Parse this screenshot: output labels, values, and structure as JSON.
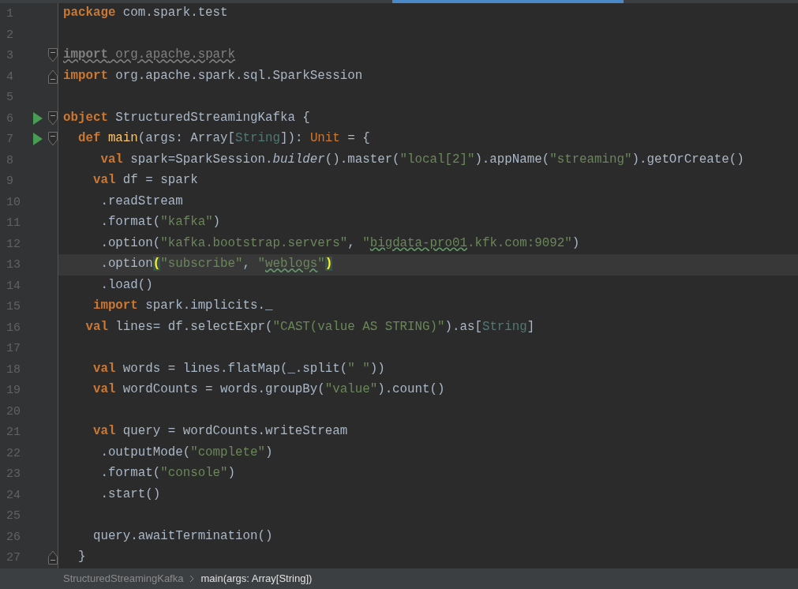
{
  "editor": {
    "lines": [
      {
        "number": "1",
        "run": false,
        "fold_start": false,
        "fold_end": false,
        "current": false,
        "tokens": [
          {
            "kind": "keyword",
            "text": "package"
          },
          {
            "kind": "plain",
            "text": " com.spark.test"
          }
        ]
      },
      {
        "number": "2",
        "run": false,
        "fold_start": false,
        "fold_end": false,
        "current": false
      },
      {
        "number": "3",
        "run": false,
        "fold_start": true,
        "fold_end": false,
        "current": false,
        "tokens": [
          {
            "kind": "unused-keyword",
            "text": "import"
          },
          {
            "kind": "unused",
            "text": " org.apache.spark"
          }
        ]
      },
      {
        "number": "4",
        "run": false,
        "fold_start": false,
        "fold_end": true,
        "current": false,
        "tokens": [
          {
            "kind": "keyword",
            "text": "import"
          },
          {
            "kind": "plain",
            "text": " org.apache.spark.sql.SparkSession"
          }
        ]
      },
      {
        "number": "5",
        "run": false,
        "fold_start": false,
        "fold_end": false,
        "current": false
      },
      {
        "number": "6",
        "run": true,
        "fold_start": true,
        "fold_end": false,
        "current": false,
        "tokens": [
          {
            "kind": "keyword",
            "text": "object"
          },
          {
            "kind": "plain",
            "text": " StructuredStreamingKafka {"
          }
        ]
      },
      {
        "number": "7",
        "run": true,
        "fold_start": true,
        "fold_end": false,
        "current": false,
        "tokens": [
          {
            "kind": "keyword",
            "text": "  def "
          },
          {
            "kind": "decl",
            "text": "main"
          },
          {
            "kind": "plain",
            "text": "(args: Array["
          },
          {
            "kind": "type",
            "text": "String"
          },
          {
            "kind": "plain",
            "text": "]): "
          },
          {
            "kind": "builtin",
            "text": "Unit"
          },
          {
            "kind": "plain",
            "text": " = {"
          }
        ]
      },
      {
        "number": "8",
        "run": false,
        "fold_start": false,
        "fold_end": false,
        "current": false,
        "tokens": [
          {
            "kind": "keyword",
            "text": "     val"
          },
          {
            "kind": "plain",
            "text": " spark=SparkSession."
          },
          {
            "kind": "italic",
            "text": "builder"
          },
          {
            "kind": "plain",
            "text": "().master("
          },
          {
            "kind": "string",
            "text": "\"local[2]\""
          },
          {
            "kind": "plain",
            "text": ").appName("
          },
          {
            "kind": "string",
            "text": "\"streaming\""
          },
          {
            "kind": "plain",
            "text": ").getOrCreate()"
          }
        ]
      },
      {
        "number": "9",
        "run": false,
        "fold_start": false,
        "fold_end": false,
        "current": false,
        "tokens": [
          {
            "kind": "keyword",
            "text": "    val"
          },
          {
            "kind": "plain",
            "text": " df = spark"
          }
        ]
      },
      {
        "number": "10",
        "run": false,
        "fold_start": false,
        "fold_end": false,
        "current": false,
        "tokens": [
          {
            "kind": "plain",
            "text": "     .readStream"
          }
        ]
      },
      {
        "number": "11",
        "run": false,
        "fold_start": false,
        "fold_end": false,
        "current": false,
        "tokens": [
          {
            "kind": "plain",
            "text": "     .format("
          },
          {
            "kind": "string",
            "text": "\"kafka\""
          },
          {
            "kind": "plain",
            "text": ")"
          }
        ]
      },
      {
        "number": "12",
        "run": false,
        "fold_start": false,
        "fold_end": false,
        "current": false,
        "tokens": [
          {
            "kind": "plain",
            "text": "     .option("
          },
          {
            "kind": "string",
            "text": "\"kafka.bootstrap.servers\""
          },
          {
            "kind": "plain",
            "text": ", "
          },
          {
            "kind": "string",
            "text": "\""
          },
          {
            "kind": "typo",
            "text": "bigdata-pro01"
          },
          {
            "kind": "string",
            "text": ".kfk.com:9092\""
          },
          {
            "kind": "plain",
            "text": ")"
          }
        ]
      },
      {
        "number": "13",
        "run": false,
        "fold_start": false,
        "fold_end": false,
        "current": true,
        "tokens": [
          {
            "kind": "plain",
            "text": "     .option"
          },
          {
            "kind": "brace-match",
            "text": "("
          },
          {
            "kind": "string",
            "text": "\"subscribe\""
          },
          {
            "kind": "plain",
            "text": ", "
          },
          {
            "kind": "string",
            "text": "\""
          },
          {
            "kind": "typo",
            "text": "weblogs"
          },
          {
            "kind": "string",
            "text": "\""
          },
          {
            "kind": "brace-match",
            "text": ")"
          }
        ]
      },
      {
        "number": "14",
        "run": false,
        "fold_start": false,
        "fold_end": false,
        "current": false,
        "tokens": [
          {
            "kind": "plain",
            "text": "     .load()"
          }
        ]
      },
      {
        "number": "15",
        "run": false,
        "fold_start": false,
        "fold_end": false,
        "current": false,
        "tokens": [
          {
            "kind": "keyword",
            "text": "    import"
          },
          {
            "kind": "plain",
            "text": " spark.implicits._"
          }
        ]
      },
      {
        "number": "16",
        "run": false,
        "fold_start": false,
        "fold_end": false,
        "current": false,
        "tokens": [
          {
            "kind": "keyword",
            "text": "   val"
          },
          {
            "kind": "plain",
            "text": " lines= df.selectExpr("
          },
          {
            "kind": "string",
            "text": "\"CAST(value AS STRING)\""
          },
          {
            "kind": "plain",
            "text": ").as["
          },
          {
            "kind": "type",
            "text": "String"
          },
          {
            "kind": "plain",
            "text": "]"
          }
        ]
      },
      {
        "number": "17",
        "run": false,
        "fold_start": false,
        "fold_end": false,
        "current": false
      },
      {
        "number": "18",
        "run": false,
        "fold_start": false,
        "fold_end": false,
        "current": false,
        "tokens": [
          {
            "kind": "keyword",
            "text": "    val"
          },
          {
            "kind": "plain",
            "text": " words = lines.flatMap(_.split("
          },
          {
            "kind": "string",
            "text": "\" \""
          },
          {
            "kind": "plain",
            "text": "))"
          }
        ]
      },
      {
        "number": "19",
        "run": false,
        "fold_start": false,
        "fold_end": false,
        "current": false,
        "tokens": [
          {
            "kind": "keyword",
            "text": "    val"
          },
          {
            "kind": "plain",
            "text": " wordCounts = words.groupBy("
          },
          {
            "kind": "string",
            "text": "\"value\""
          },
          {
            "kind": "plain",
            "text": ").count()"
          }
        ]
      },
      {
        "number": "20",
        "run": false,
        "fold_start": false,
        "fold_end": false,
        "current": false
      },
      {
        "number": "21",
        "run": false,
        "fold_start": false,
        "fold_end": false,
        "current": false,
        "tokens": [
          {
            "kind": "keyword",
            "text": "    val"
          },
          {
            "kind": "plain",
            "text": " query = wordCounts.writeStream"
          }
        ]
      },
      {
        "number": "22",
        "run": false,
        "fold_start": false,
        "fold_end": false,
        "current": false,
        "tokens": [
          {
            "kind": "plain",
            "text": "     .outputMode("
          },
          {
            "kind": "string",
            "text": "\"complete\""
          },
          {
            "kind": "plain",
            "text": ")"
          }
        ]
      },
      {
        "number": "23",
        "run": false,
        "fold_start": false,
        "fold_end": false,
        "current": false,
        "tokens": [
          {
            "kind": "plain",
            "text": "     .format("
          },
          {
            "kind": "string",
            "text": "\"console\""
          },
          {
            "kind": "plain",
            "text": ")"
          }
        ]
      },
      {
        "number": "24",
        "run": false,
        "fold_start": false,
        "fold_end": false,
        "current": false,
        "tokens": [
          {
            "kind": "plain",
            "text": "     .start()"
          }
        ]
      },
      {
        "number": "25",
        "run": false,
        "fold_start": false,
        "fold_end": false,
        "current": false
      },
      {
        "number": "26",
        "run": false,
        "fold_start": false,
        "fold_end": false,
        "current": false,
        "tokens": [
          {
            "kind": "plain",
            "text": "    query.awaitTermination()"
          }
        ]
      },
      {
        "number": "27",
        "run": false,
        "fold_start": false,
        "fold_end": true,
        "current": false,
        "tokens": [
          {
            "kind": "plain",
            "text": "  }"
          }
        ]
      }
    ]
  },
  "breadcrumb": [
    {
      "label": "StructuredStreamingKafka",
      "selected": false
    },
    {
      "label": "main(args: Array[String])",
      "selected": true
    }
  ]
}
